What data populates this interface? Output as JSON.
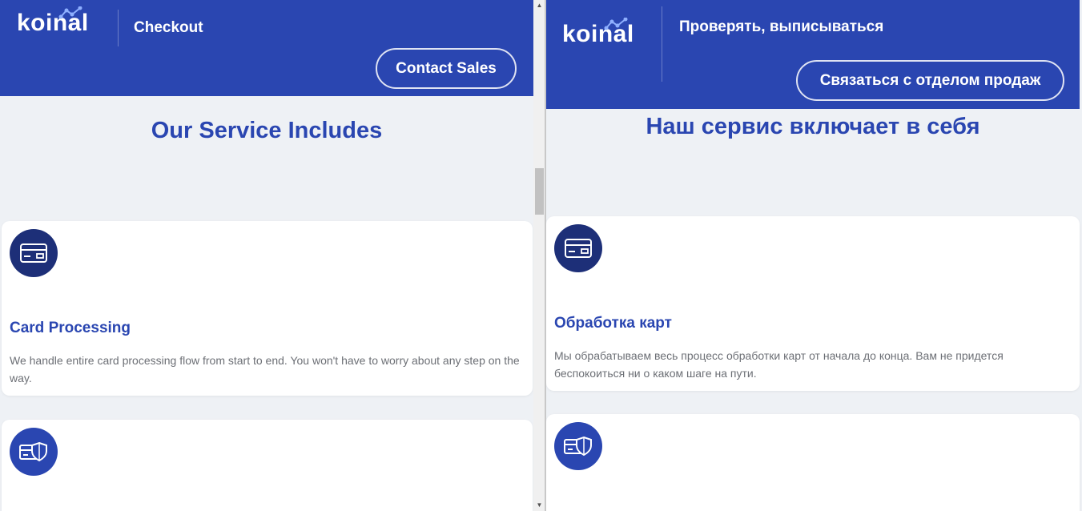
{
  "left": {
    "brand": "koinal",
    "page_title": "Checkout",
    "contact_label": "Contact Sales",
    "section_title": "Our Service Includes",
    "cards": [
      {
        "icon": "credit-card-icon",
        "title": "Card Processing",
        "description": "We handle entire card processing flow from start to end. You won't have to worry about any step on the way."
      },
      {
        "icon": "card-shield-icon"
      }
    ]
  },
  "right": {
    "brand": "koinal",
    "page_title": "Проверять, выписываться",
    "contact_label": "Связаться с отделом продаж",
    "section_title": "Наш сервис включает в себя",
    "cards": [
      {
        "icon": "credit-card-icon",
        "title": "Обработка карт",
        "description": "Мы обрабатываем весь процесс обработки карт от начала до конца. Вам не придется беспокоиться ни о каком шаге на пути."
      },
      {
        "icon": "card-shield-icon"
      }
    ]
  },
  "colors": {
    "header_bg": "#2a46b1",
    "heading": "#2a46b1",
    "icon_dark": "#1d2f78",
    "page_bg": "#eef1f5"
  },
  "scrollbar": {
    "up_arrow": "▲",
    "down_arrow": "▼"
  }
}
